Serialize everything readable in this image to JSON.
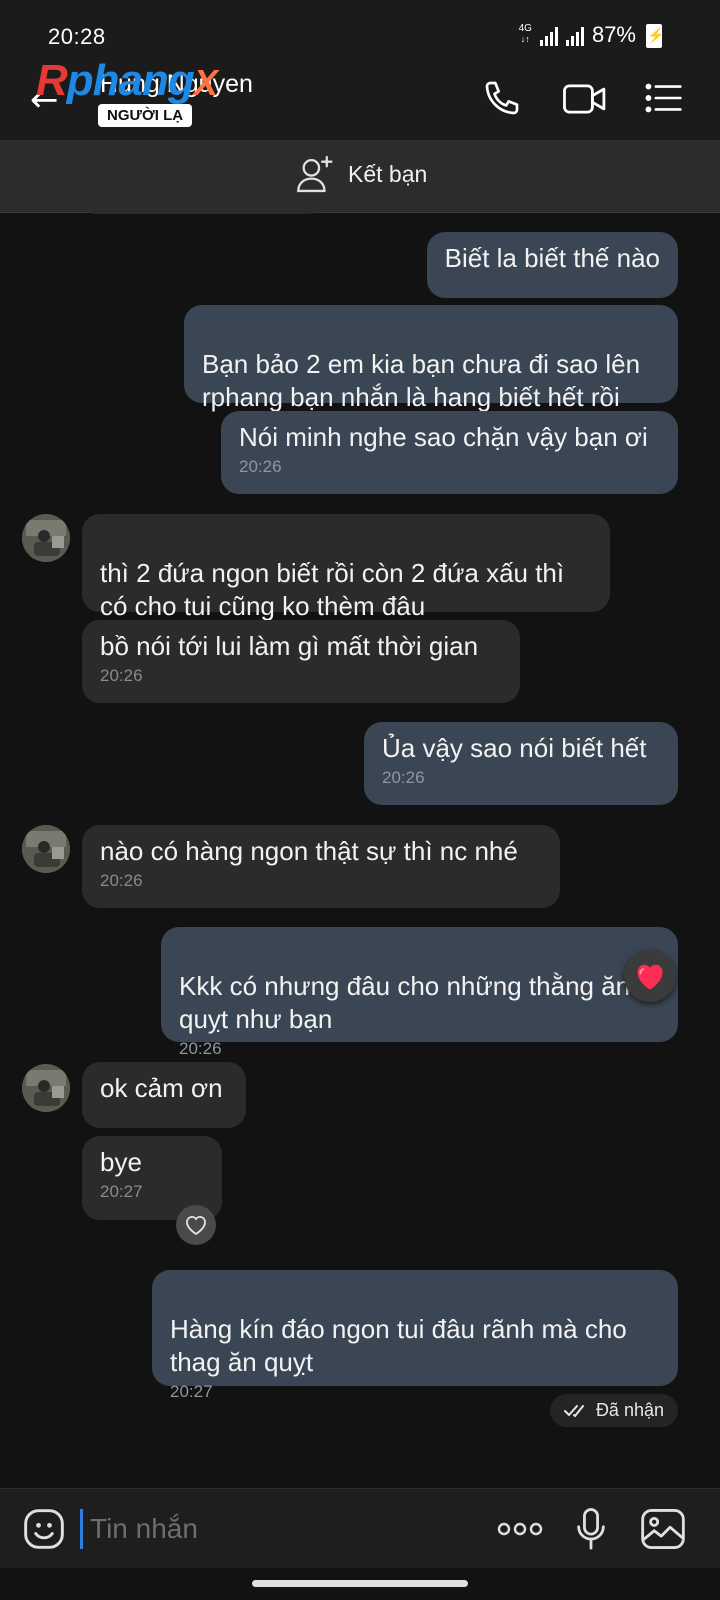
{
  "status_bar": {
    "time": "20:28",
    "network": "4G",
    "battery": "87%"
  },
  "header": {
    "watermark_prefix": "R",
    "watermark_mid": "phang",
    "watermark_suffix": "X",
    "contact_name": "Hung Nguyen",
    "stranger_badge": "NGƯỜI LẠ"
  },
  "add_friend": {
    "label": "Kết bạn"
  },
  "messages": [
    {
      "side": "sent",
      "text": "Biết la biết thế nào"
    },
    {
      "side": "sent",
      "text": "Bạn bảo 2 em kia bạn chưa đi sao lên\nrphang bạn nhắn là hang biết hết rồi"
    },
    {
      "side": "sent",
      "text": "Nói minh nghe sao chặn vậy bạn ơi",
      "time": "20:26"
    },
    {
      "side": "received",
      "text": "thì 2 đứa ngon biết rồi còn 2 đứa xấu thì\ncó cho tui cũng ko thèm đâu"
    },
    {
      "side": "received",
      "text": "bồ nói tới lui làm gì mất thời gian",
      "time": "20:26"
    },
    {
      "side": "sent",
      "text": "Ủa vậy sao nói biết hết",
      "time": "20:26"
    },
    {
      "side": "received",
      "text": "nào có hàng ngon thật sự thì nc nhé",
      "time": "20:26"
    },
    {
      "side": "sent",
      "text": "Kkk có nhưng đâu cho những thằng ăn\nquỵt như bạn",
      "time": "20:26"
    },
    {
      "side": "received",
      "text": "ok cảm ơn"
    },
    {
      "side": "received",
      "text": "bye",
      "time": "20:27"
    },
    {
      "side": "sent",
      "text": "Hàng kín đáo ngon tui đâu rãnh mà cho\nthag ăn quỵt",
      "time": "20:27"
    }
  ],
  "delivery_status": "Đã nhận",
  "composer": {
    "placeholder": "Tin nhắn"
  },
  "colors": {
    "sent_bubble": "#3a4654",
    "received_bubble": "#2b2b2b",
    "background": "#121212",
    "accent": "#2f7de1"
  },
  "icons": [
    "back-arrow-icon",
    "phone-icon",
    "video-call-icon",
    "menu-list-icon",
    "add-person-icon",
    "heart-reaction-icon",
    "heart-outline-icon",
    "double-check-icon",
    "emoji-icon",
    "more-icon",
    "microphone-icon",
    "image-icon"
  ]
}
